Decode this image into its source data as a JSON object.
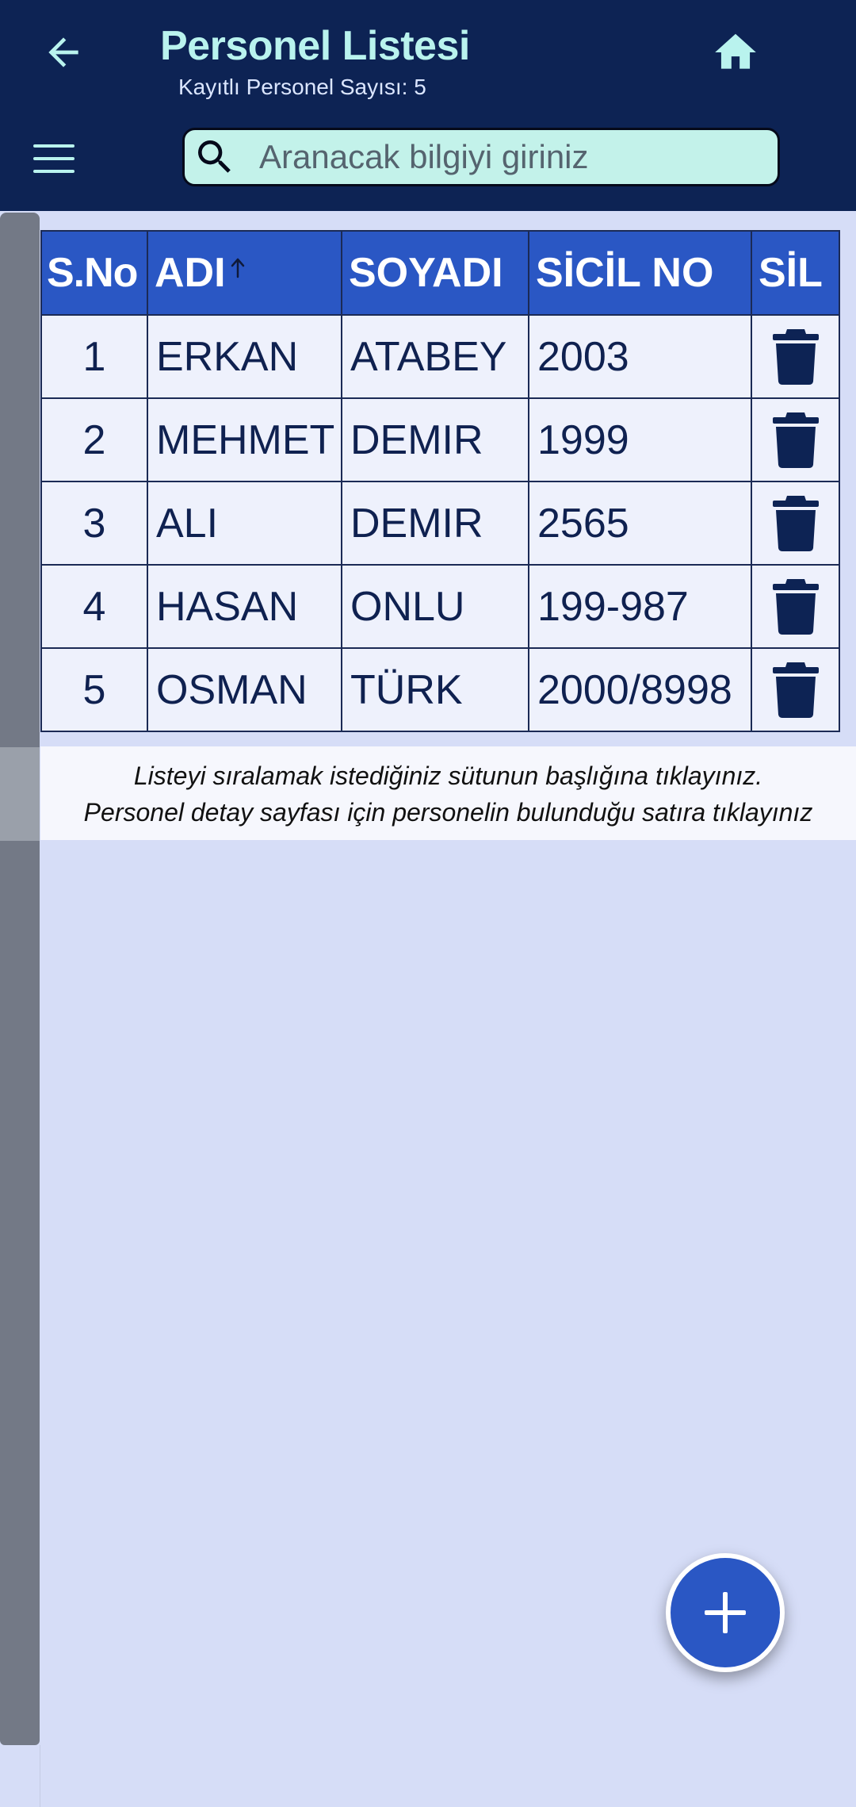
{
  "header": {
    "title": "Personel Listesi",
    "subtitle": "Kayıtlı Personel Sayısı: 5"
  },
  "search": {
    "placeholder": "Aranacak bilgiyi giriniz",
    "value": ""
  },
  "table": {
    "columns": {
      "sno": "S.No",
      "adi": "ADI",
      "soyadi": "SOYADI",
      "sicil": "SİCİL NO",
      "sil": "SİL"
    },
    "sorted_column": "ADI",
    "sort_direction": "ascending",
    "rows": [
      {
        "sno": "1",
        "adi": "ERKAN",
        "soyadi": "ATABEY",
        "sicil": "2003"
      },
      {
        "sno": "2",
        "adi": "MEHMET",
        "soyadi": "DEMIR",
        "sicil": "1999"
      },
      {
        "sno": "3",
        "adi": "ALI",
        "soyadi": "DEMIR",
        "sicil": "2565"
      },
      {
        "sno": "4",
        "adi": "HASAN",
        "soyadi": "ONLU",
        "sicil": "199-987"
      },
      {
        "sno": "5",
        "adi": "OSMAN",
        "soyadi": "TÜRK",
        "sicil": "2000/8998"
      }
    ]
  },
  "info": {
    "line1": "Listeyi sıralamak istediğiniz sütunun başlığına tıklayınız.",
    "line2": "Personel detay sayfası için personelin bulunduğu satıra tıklayınız"
  },
  "icons": {
    "back": "arrow-back-icon",
    "home": "home-icon",
    "menu": "hamburger-menu-icon",
    "search": "search-icon",
    "sort": "arrow-up-icon",
    "delete": "trash-icon",
    "add": "plus-icon"
  },
  "colors": {
    "header_bg": "#0d2354",
    "title": "#b9f3ee",
    "accent": "#2a57c4",
    "page_bg": "#d6ddf7",
    "search_bg": "#c3f2ea",
    "text_dark": "#0f2150"
  }
}
